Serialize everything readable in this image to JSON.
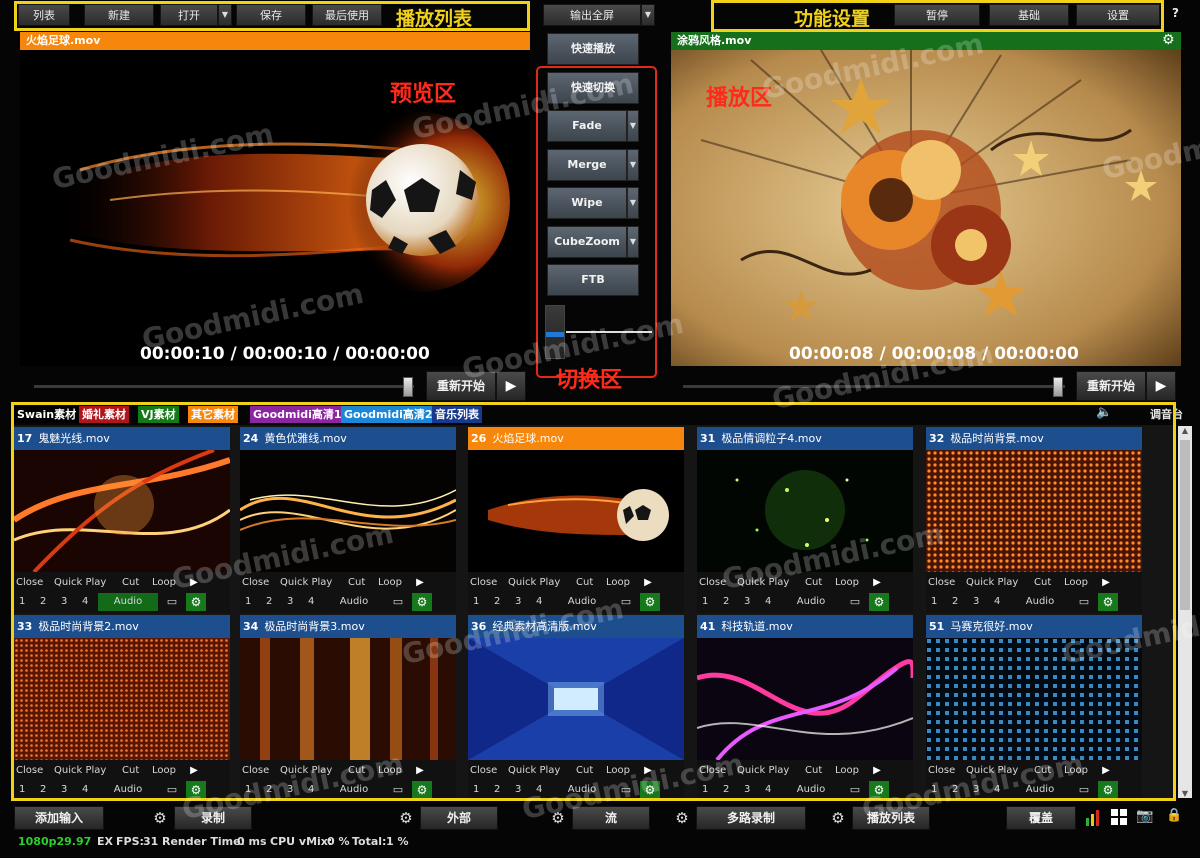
{
  "top": {
    "playlist_buttons": [
      "列表",
      "新建",
      "打开",
      "保存",
      "最后使用"
    ],
    "annotation_playlist": "播放列表",
    "output_fullscreen": "输出全屏",
    "annotation_function": "功能设置",
    "function_buttons": [
      "暂停",
      "基础",
      "设置"
    ],
    "help": "?"
  },
  "preview": {
    "title": "火焰足球.mov",
    "annotation": "预览区",
    "timecode": "00:00:10  /  00:00:10  /  00:00:00",
    "restart": "重新开始",
    "slider_position": 0.98
  },
  "transition": {
    "quick_play": "快速播放",
    "quick_cut": "快速切换",
    "effects": [
      "Fade",
      "Merge",
      "Wipe",
      "CubeZoom"
    ],
    "ftb": "FTB",
    "annotation": "切换区"
  },
  "output": {
    "title": "涂鸦风格.mov",
    "annotation": "播放区",
    "timecode": "00:00:08  /  00:00:08  /  00:00:00",
    "restart": "重新开始",
    "slider_position": 0.98
  },
  "tabs": [
    {
      "label": "Swain素材",
      "color": "#000000"
    },
    {
      "label": "婚礼素材",
      "color": "#b0151c"
    },
    {
      "label": "VJ素材",
      "color": "#137a17"
    },
    {
      "label": "其它素材",
      "color": "#f7870c"
    },
    {
      "label": "Goodmidi高清1",
      "color": "#8c25a0"
    },
    {
      "label": "Goodmidi高清2",
      "color": "#1c87d6"
    },
    {
      "label": "音乐列表",
      "color": "#173a8c"
    }
  ],
  "mixer_label": "调音台",
  "card_controls": {
    "close": "Close",
    "quick_play": "Quick Play",
    "cut": "Cut",
    "loop": "Loop",
    "numbers": [
      "1",
      "2",
      "3",
      "4"
    ],
    "audio": "Audio"
  },
  "inputs": [
    {
      "num": "17",
      "name": "鬼魅光线.mov",
      "active": false,
      "audio_on": true,
      "thumb": "swirl"
    },
    {
      "num": "24",
      "name": "黄色优雅线.mov",
      "active": false,
      "audio_on": false,
      "thumb": "ribbon"
    },
    {
      "num": "26",
      "name": "火焰足球.mov",
      "active": true,
      "audio_on": false,
      "thumb": "fireball"
    },
    {
      "num": "31",
      "name": "极品情调粒子4.mov",
      "active": false,
      "audio_on": false,
      "thumb": "particles"
    },
    {
      "num": "32",
      "name": "极品时尚背景.mov",
      "active": false,
      "audio_on": false,
      "thumb": "dots"
    },
    {
      "num": "33",
      "name": "极品时尚背景2.mov",
      "active": false,
      "audio_on": false,
      "thumb": "dots2"
    },
    {
      "num": "34",
      "name": "极品时尚背景3.mov",
      "active": false,
      "audio_on": false,
      "thumb": "lights"
    },
    {
      "num": "36",
      "name": "经典素材高清版.mov",
      "active": false,
      "audio_on": false,
      "thumb": "tunnel"
    },
    {
      "num": "41",
      "name": "科技轨道.mov",
      "active": false,
      "audio_on": false,
      "thumb": "track"
    },
    {
      "num": "51",
      "name": "马赛克很好.mov",
      "active": false,
      "audio_on": false,
      "thumb": "mosaic"
    }
  ],
  "bottom": {
    "add_input": "添加输入",
    "record": "录制",
    "external": "外部",
    "stream": "流",
    "multi_record": "多路录制",
    "playlist": "播放列表",
    "overlay": "覆盖"
  },
  "status": {
    "format": "1080p29.97",
    "ex": "EX",
    "fps_label": "FPS:",
    "fps": "31",
    "render_label": "Render Time:",
    "render": "0 ms",
    "cpu_label": "CPU vMix:",
    "cpu": "0 %",
    "total_label": "Total:",
    "total": "1 %"
  },
  "watermark": "Goodmidi.com"
}
